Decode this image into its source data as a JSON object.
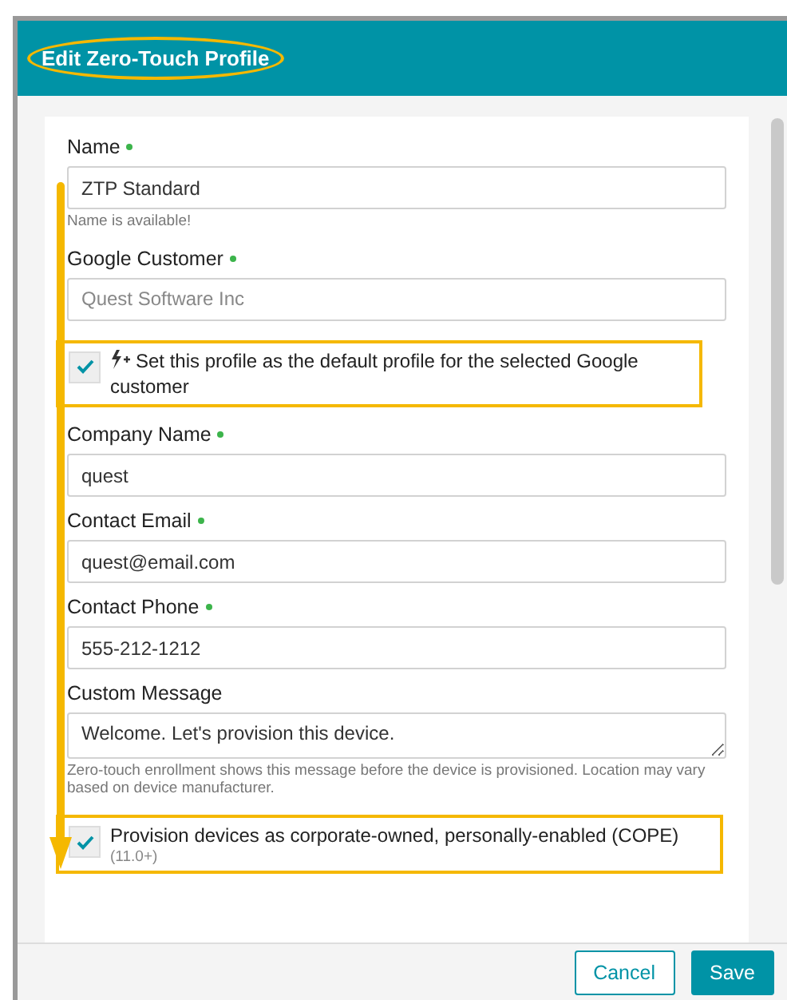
{
  "dialog": {
    "title": "Edit Zero-Touch Profile",
    "title_highlighted": true
  },
  "fields": [
    {
      "kind": "text",
      "label": "Name",
      "required": true,
      "value": "ZTP Standard",
      "hint": "Name is available!"
    },
    {
      "kind": "text",
      "label": "Google Customer",
      "required": true,
      "placeholder": "Quest Software Inc"
    },
    {
      "kind": "checkbox",
      "label": "Set this profile as the default profile for the selected Google customer",
      "checked": true,
      "highlighted": true,
      "bolt": true
    },
    {
      "kind": "text",
      "label": "Company Name",
      "required": true,
      "value": "quest"
    },
    {
      "kind": "text",
      "label": "Contact Email",
      "required": true,
      "value": "quest@email.com"
    },
    {
      "kind": "text",
      "label": "Contact Phone",
      "required": true,
      "value": "555-212-1212"
    },
    {
      "kind": "textarea",
      "label": "Custom Message",
      "required": false,
      "value": "Welcome. Let's provision this device.",
      "hint": "Zero-touch enrollment shows this message before the device is provisioned. Location may vary based on device manufacturer."
    },
    {
      "kind": "checkbox",
      "label": "Provision devices as corporate-owned, personally-enabled (COPE)",
      "note": "(11.0+)",
      "checked": true,
      "highlighted": true,
      "bolt": false
    }
  ],
  "buttons": [
    {
      "kind": "secondary",
      "label": "Cancel"
    },
    {
      "kind": "primary",
      "label": "Save"
    }
  ]
}
